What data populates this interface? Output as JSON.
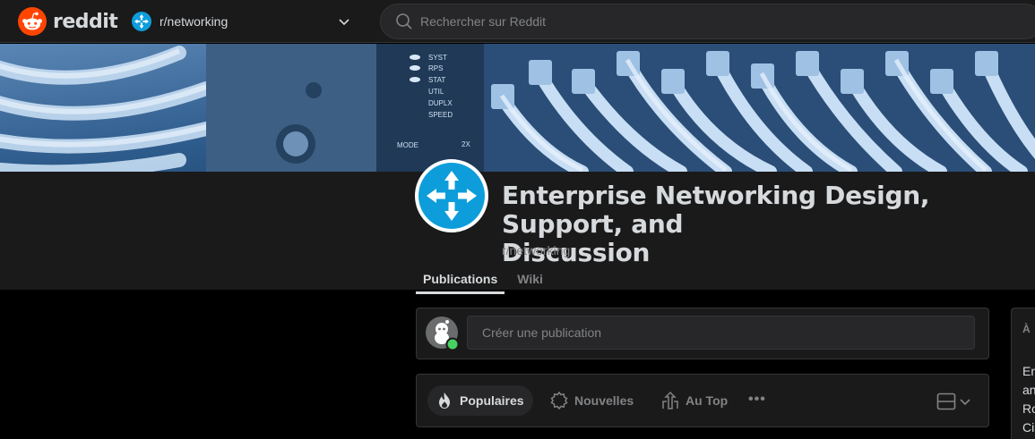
{
  "header": {
    "brand": "reddit",
    "community": "r/networking",
    "search_placeholder": "Rechercher sur Reddit"
  },
  "banner": {
    "panel_labels": [
      "SYST",
      "RPS",
      "STAT",
      "UTIL",
      "DUPLX",
      "SPEED"
    ],
    "mode_label": "MODE",
    "port_label": "2X"
  },
  "community": {
    "title_line1": "Enterprise Networking Design, Support, and",
    "title_line2": "Discussion",
    "name": "r/networking",
    "tabs": [
      {
        "label": "Publications",
        "active": true
      },
      {
        "label": "Wiki",
        "active": false
      }
    ]
  },
  "create_post": {
    "placeholder": "Créer une publication"
  },
  "sort": {
    "options": [
      {
        "label": "Populaires",
        "icon": "flame-icon",
        "active": true
      },
      {
        "label": "Nouvelles",
        "icon": "sparkle-badge-icon",
        "active": false
      },
      {
        "label": "Au Top",
        "icon": "top-chart-icon",
        "active": false
      }
    ],
    "more": "•••"
  },
  "sidebar": {
    "heading": "À",
    "lines": [
      "En",
      "an",
      "Ro",
      "Cis"
    ]
  },
  "colors": {
    "brand_orange": "#ff4500",
    "community_blue": "#0d9ddb",
    "online_green": "#46d160"
  }
}
